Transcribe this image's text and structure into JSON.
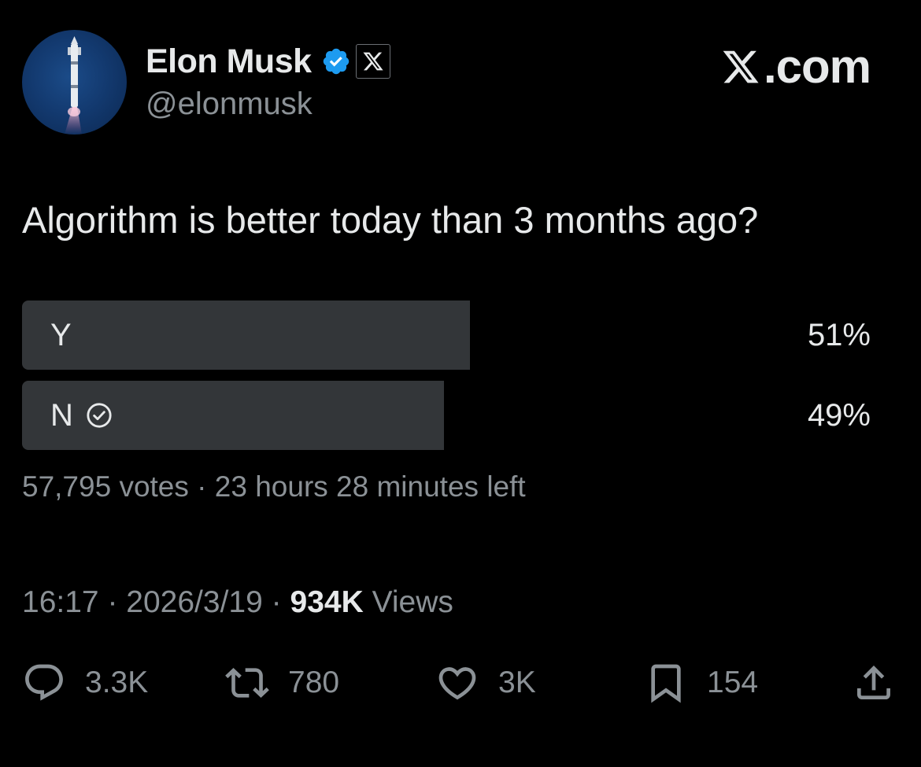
{
  "author": {
    "display_name": "Elon Musk",
    "handle": "@elonmusk",
    "verified": true,
    "avatar_icon": "rocket-avatar"
  },
  "brand": {
    "label": ".com",
    "logo_icon": "x-logo-icon"
  },
  "tweet": {
    "text": "Algorithm is better today than 3 months ago?"
  },
  "poll": {
    "options": [
      {
        "label": "Y",
        "percent_label": "51%",
        "percent": 51,
        "selected": false
      },
      {
        "label": "N",
        "percent_label": "49%",
        "percent": 49,
        "selected": true
      }
    ],
    "votes": "57,795 votes",
    "separator": "·",
    "time_left": "23 hours 28 minutes left"
  },
  "meta": {
    "time": "16:17",
    "date": "2026/3/19",
    "separator": "·",
    "views_count": "934K",
    "views_label": "Views"
  },
  "actions": {
    "reply": {
      "count": "3.3K",
      "icon": "reply-icon"
    },
    "repost": {
      "count": "780",
      "icon": "repost-icon"
    },
    "like": {
      "count": "3K",
      "icon": "heart-icon"
    },
    "bookmark": {
      "count": "154",
      "icon": "bookmark-icon"
    },
    "share": {
      "icon": "share-icon"
    }
  },
  "colors": {
    "background": "#000000",
    "text_primary": "#e7e9ea",
    "text_secondary": "#8b9196",
    "poll_bar": "#333639",
    "verified_blue": "#1d9bf0"
  }
}
